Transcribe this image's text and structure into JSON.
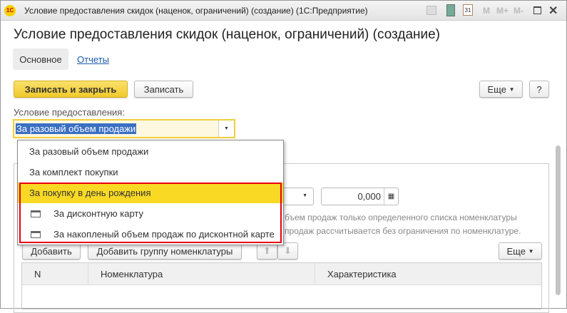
{
  "window": {
    "title": "Условие предоставления скидок (наценок, ограничений) (создание)  (1С:Предприятие)",
    "tools": [
      "M",
      "M+",
      "M-"
    ]
  },
  "page_title": "Условие предоставления скидок (наценок, ограничений) (создание)",
  "tabs": [
    {
      "label": "Основное"
    },
    {
      "label": "Отчеты"
    }
  ],
  "toolbar": {
    "save_close": "Записать и закрыть",
    "save": "Записать",
    "more": "Еще",
    "help": "?"
  },
  "condition": {
    "label": "Условие предоставления:",
    "value": "За разовый объем продажи"
  },
  "dropdown": {
    "options": [
      "За разовый объем продажи",
      "За комплект покупки",
      "За покупку в день рождения",
      "За дисконтную карту",
      "За накопленый объем продаж по дисконтной карте"
    ],
    "highlighted": 2
  },
  "amount": "0,000",
  "hint": [
    "бъем продаж только определенного списка номенклатуры",
    "продаж рассчитывается без ограничения по номенклатуре."
  ],
  "table_toolbar": {
    "add": "Добавить",
    "add_group": "Добавить группу номенклатуры",
    "more": "Еще"
  },
  "table": {
    "columns": [
      "N",
      "Номенклатура",
      "Характеристика"
    ]
  },
  "colors": {
    "accent": "#f5d12a",
    "highlight_border": "#e8000c"
  }
}
